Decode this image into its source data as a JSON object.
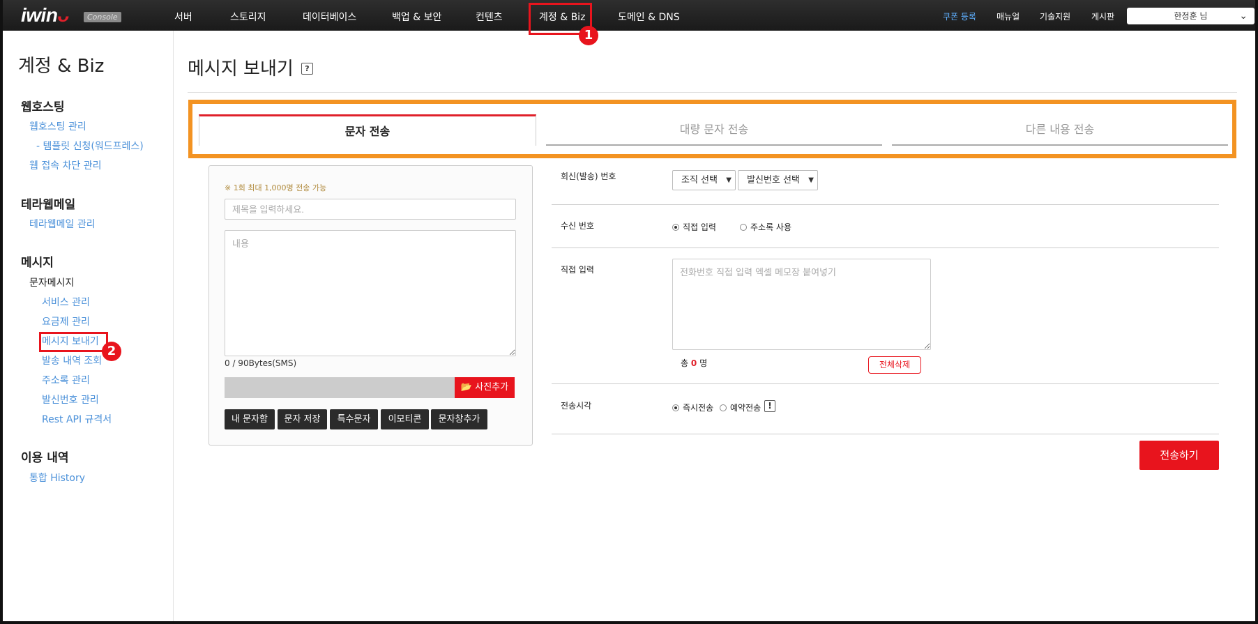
{
  "logo": {
    "main": "iwin",
    "console": "Console"
  },
  "topnav": [
    "서버",
    "스토리지",
    "데이터베이스",
    "백업 & 보안",
    "컨텐츠",
    "계정 & Biz",
    "도메인 & DNS"
  ],
  "toplinks": [
    "쿠폰 등록",
    "매뉴얼",
    "기술지원",
    "게시판"
  ],
  "user": {
    "name": "한정훈 님"
  },
  "annotations": {
    "one": "1",
    "two": "2"
  },
  "sidebar": {
    "title": "계정 & Biz",
    "sections": [
      {
        "heading": "웹호스팅",
        "items": [
          "웹호스팅 관리",
          "- 템플릿 신청(워드프레스)",
          "웹 접속 차단 관리"
        ]
      },
      {
        "heading": "테라웹메일",
        "items": [
          "테라웹메일 관리"
        ]
      },
      {
        "heading": "메시지",
        "sub": "문자메시지",
        "items": [
          "서비스 관리",
          "요금제 관리",
          "메시지 보내기",
          "발송 내역 조회",
          "주소록 관리",
          "발신번호 관리",
          "Rest API 규격서"
        ]
      },
      {
        "heading": "이용 내역",
        "items": [
          "통합 History"
        ]
      }
    ]
  },
  "main": {
    "title": "메시지 보내기",
    "help": "?",
    "tabs": [
      "문자 전송",
      "대량 문자 전송",
      "다른 내용 전송"
    ],
    "compose": {
      "note": "※ 1회 최대 1,000명 전송 가능",
      "subject_placeholder": "제목을 입력하세요.",
      "content_placeholder": "내용",
      "bytes": "0 / 90Bytes(SMS)",
      "photo_button": "사진추가",
      "buttons": [
        "내 문자함",
        "문자 저장",
        "특수문자",
        "이모티콘",
        "문자창추가"
      ]
    },
    "form": {
      "reply_label": "회신(발송) 번호",
      "org_select": "조직 선택",
      "sender_select": "발신번호 선택",
      "recv_label": "수신 번호",
      "recv_options": [
        "직접 입력",
        "주소록 사용"
      ],
      "direct_label": "직접 입력",
      "phones_placeholder": "전화번호 직접 입력 엑셀 메모장 붙여넣기",
      "count_prefix": "총",
      "count_value": "0",
      "count_suffix": "명",
      "clear_button": "전체삭제",
      "time_label": "전송시각",
      "time_options": [
        "즉시전송",
        "예약전송"
      ],
      "info": "!"
    },
    "send_button": "전송하기"
  },
  "colors": {
    "accent": "#e8141d",
    "orange": "#f39322",
    "link": "#4a90d9"
  }
}
